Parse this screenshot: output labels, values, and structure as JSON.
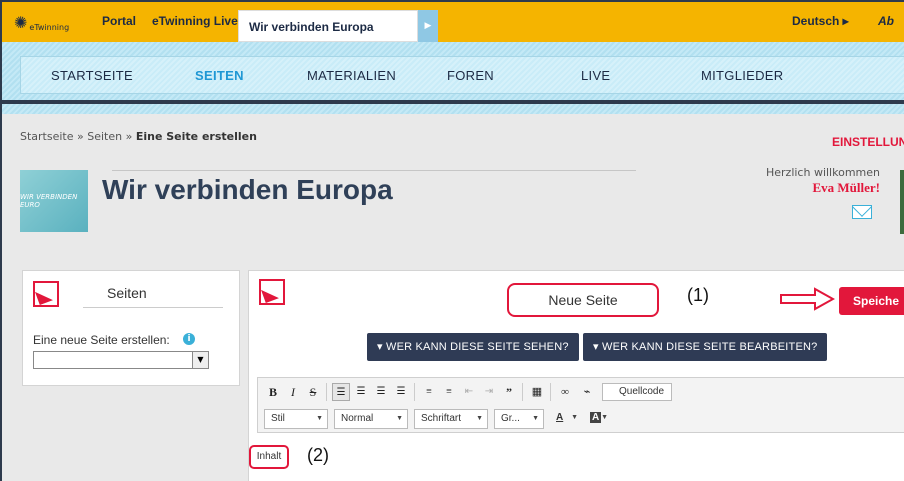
{
  "topbar": {
    "logo_text": "eTwinning",
    "links": [
      "Portal",
      "eTwinning Live"
    ],
    "active_tab": "Wir verbinden Europa",
    "language": "Deutsch ▸",
    "truncated_link": "Ab"
  },
  "nav": {
    "items": [
      {
        "label": "STARTSEITE",
        "active": false
      },
      {
        "label": "SEITEN",
        "active": true
      },
      {
        "label": "MATERIALIEN",
        "active": false
      },
      {
        "label": "FOREN",
        "active": false
      },
      {
        "label": "LIVE",
        "active": false
      },
      {
        "label": "MITGLIEDER",
        "active": false
      }
    ]
  },
  "breadcrumb": {
    "items": [
      "Startseite",
      "Seiten"
    ],
    "separator": "»",
    "current": "Eine Seite erstellen"
  },
  "header": {
    "settings_label": "EINSTELLUN",
    "hero_text": "WIR VERBINDEN EURO",
    "title": "Wir verbinden Europa",
    "welcome_text": "Herzlich willkommen",
    "user_name": "Eva Müller!"
  },
  "sidebar": {
    "title": "Seiten",
    "new_page_label": "Eine neue Seite erstellen:",
    "info_icon_glyph": "i",
    "select_value": ""
  },
  "editor": {
    "page_title_value": "Neue Seite",
    "callout_1": "(1)",
    "save_label": "Speiche",
    "perm_view_label": "WER KANN DIESE SEITE SEHEN?",
    "perm_edit_label": "WER KANN DIESE SEITE BEARBEITEN?",
    "perm_glyph": "▾",
    "toolbar": {
      "bold": "B",
      "italic": "I",
      "strike": "S",
      "source_label": "Quellcode",
      "style_combo": "Stil",
      "format_combo": "Normal",
      "font_combo": "Schriftart",
      "size_combo": "Gr...",
      "text_color": "A",
      "bg_color": "A"
    },
    "content_placeholder": "Inhalt",
    "callout_2": "(2)"
  },
  "colors": {
    "topbar": "#f5b400",
    "accent_red": "#e2173b",
    "nav_active": "#1f97d4",
    "dark_button": "#2f3b55"
  }
}
